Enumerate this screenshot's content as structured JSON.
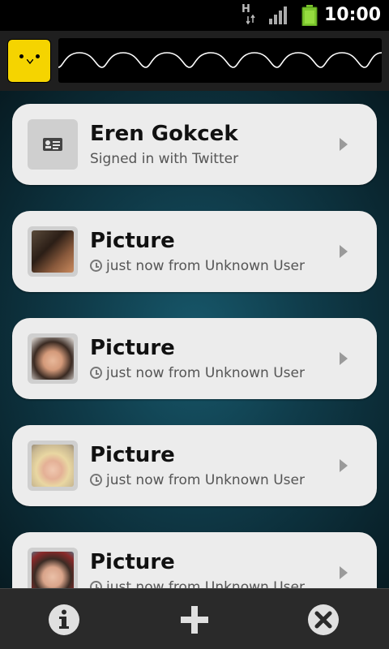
{
  "status_bar": {
    "network_label": "H",
    "time": "10:00",
    "icons": [
      "network-h-icon",
      "signal-icon",
      "battery-icon"
    ]
  },
  "header": {
    "logo_icon": "yellow-face-logo",
    "banner_icon": "wave-pattern"
  },
  "account": {
    "name": "Eren Gokcek",
    "status": "Signed in with Twitter",
    "icon": "contact-card-icon"
  },
  "items": [
    {
      "title": "Picture",
      "subtitle": "just now from Unknown User"
    },
    {
      "title": "Picture",
      "subtitle": "just now from Unknown User"
    },
    {
      "title": "Picture",
      "subtitle": "just now from Unknown User"
    },
    {
      "title": "Picture",
      "subtitle": "just now from Unknown User"
    }
  ],
  "bottom_bar": {
    "icons": [
      "info-icon",
      "add-icon",
      "close-icon"
    ]
  },
  "colors": {
    "accent_yellow": "#f5d400",
    "battery_green": "#7bc62d",
    "card_bg": "#ececec",
    "background_teal": "#17586b"
  }
}
